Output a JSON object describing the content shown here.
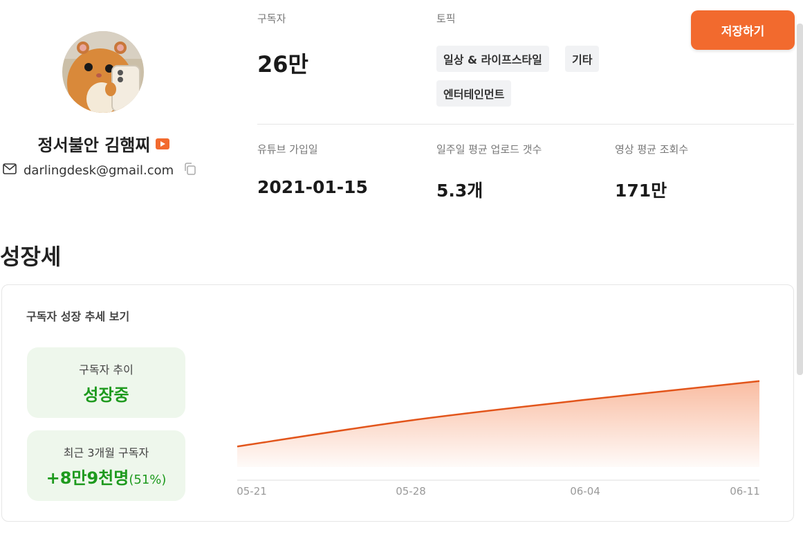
{
  "profile": {
    "channel_name": "정서불안 김햄찌",
    "email": "darlingdesk@gmail.com"
  },
  "stats": {
    "subscribers_label": "구독자",
    "subscribers_value": "26만",
    "topic_label": "토픽",
    "topics": [
      "일상 & 라이프스타일",
      "기타",
      "엔터테인먼트"
    ],
    "join_label": "유튜브 가입일",
    "join_value": "2021-01-15",
    "weekly_upload_label": "일주일 평균 업로드 갯수",
    "weekly_upload_value": "5.3개",
    "avg_views_label": "영상 평균 조회수",
    "avg_views_value": "171만"
  },
  "actions": {
    "save_label": "저장하기"
  },
  "growth": {
    "section_title": "성장세",
    "card_title": "구독자 성장 추세 보기",
    "trend_label": "구독자 추이",
    "trend_value": "성장중",
    "recent_label": "최근 3개월 구독자",
    "recent_value": "+8만9천명",
    "recent_pct": "(51%)"
  },
  "colors": {
    "accent": "#f26a2e",
    "positive": "#1e9a1e",
    "positive_bg": "#eef7ec",
    "line": "#e2551b"
  },
  "icons": {
    "email": "mail-icon",
    "copy": "copy-icon",
    "youtube": "youtube-icon"
  },
  "chart_data": {
    "type": "area",
    "categories": [
      "05-21",
      "05-28",
      "06-04",
      "06-11"
    ],
    "values": [
      0.22,
      0.5,
      0.72,
      0.92
    ],
    "ylim": [
      0,
      1
    ],
    "grid": false,
    "legend": "none"
  }
}
